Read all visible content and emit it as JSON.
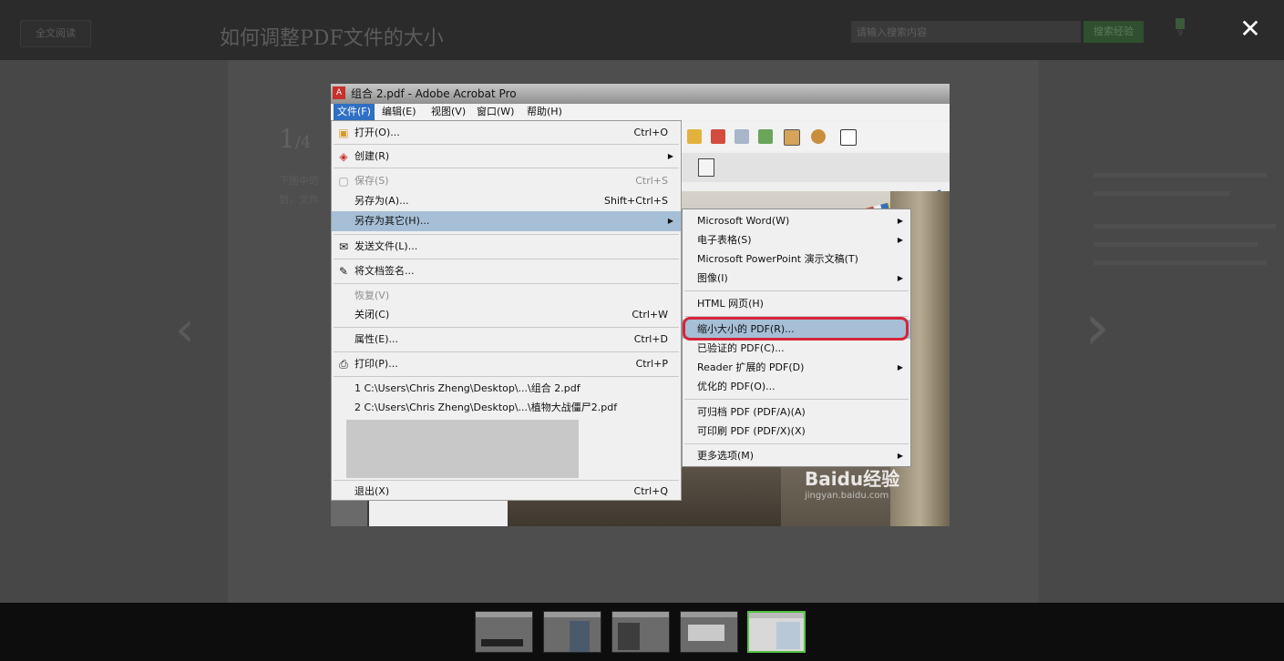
{
  "topbar": {
    "full_read_label": "全文阅读",
    "title": "如何调整PDF文件的大小",
    "search_placeholder": "请输入搜索内容",
    "search_button": "搜索经验",
    "like_count": "9",
    "close_symbol": "✕"
  },
  "step": {
    "current": "1",
    "total": "/4",
    "text_lines": [
      "下图中的",
      "到，文件"
    ]
  },
  "screenshot": {
    "window_title": "组合 2.pdf - Adobe Acrobat Pro",
    "menubar": [
      "文件(F)",
      "编辑(E)",
      "视图(V)",
      "窗口(W)",
      "帮助(H)"
    ],
    "file_menu": [
      {
        "label": "打开(O)...",
        "shortcut": "Ctrl+O",
        "icon": "open-folder-icon"
      },
      {
        "label": "创建(R)",
        "shortcut": "",
        "icon": "create-pdf-icon",
        "submenu": true
      },
      {
        "label": "保存(S)",
        "shortcut": "Ctrl+S",
        "icon": "save-icon",
        "disabled": true
      },
      {
        "label": "另存为(A)...",
        "shortcut": "Shift+Ctrl+S"
      },
      {
        "label": "另存为其它(H)...",
        "shortcut": "",
        "submenu": true,
        "highlighted": true
      },
      {
        "label": "发送文件(L)...",
        "shortcut": "",
        "icon": "envelope-icon"
      },
      {
        "label": "将文档签名...",
        "shortcut": "",
        "icon": "sign-icon"
      },
      {
        "label": "恢复(V)",
        "shortcut": "",
        "disabled": true
      },
      {
        "label": "关闭(C)",
        "shortcut": "Ctrl+W"
      },
      {
        "label": "属性(E)...",
        "shortcut": "Ctrl+D"
      },
      {
        "label": "打印(P)...",
        "shortcut": "Ctrl+P",
        "icon": "printer-icon"
      },
      {
        "label": "1 C:\\Users\\Chris Zheng\\Desktop\\...\\组合 2.pdf",
        "shortcut": ""
      },
      {
        "label": "2 C:\\Users\\Chris Zheng\\Desktop\\...\\植物大战僵尸2.pdf",
        "shortcut": ""
      },
      {
        "label": "退出(X)",
        "shortcut": "Ctrl+Q"
      }
    ],
    "submenu": [
      {
        "label": "Microsoft Word(W)",
        "submenu": true
      },
      {
        "label": "电子表格(S)",
        "submenu": true
      },
      {
        "label": "Microsoft PowerPoint 演示文稿(T)"
      },
      {
        "label": "图像(I)",
        "submenu": true
      },
      {
        "label": "HTML 网页(H)"
      },
      {
        "label": "缩小大小的 PDF(R)...",
        "highlighted": true
      },
      {
        "label": "已验证的 PDF(C)..."
      },
      {
        "label": "Reader 扩展的 PDF(D)",
        "submenu": true
      },
      {
        "label": "优化的 PDF(O)..."
      },
      {
        "label": "可归档 PDF (PDF/A)(A)"
      },
      {
        "label": "可印刷 PDF (PDF/X)(X)"
      },
      {
        "label": "更多选项(M)",
        "submenu": true
      }
    ],
    "watermark": "Baidu经验",
    "watermark_sub": "jingyan.baidu.com",
    "highlight_color": "#d6253a"
  },
  "thumbnails": [
    "step-1",
    "step-2",
    "step-3",
    "step-4",
    "step-5"
  ],
  "active_thumbnail": 5
}
